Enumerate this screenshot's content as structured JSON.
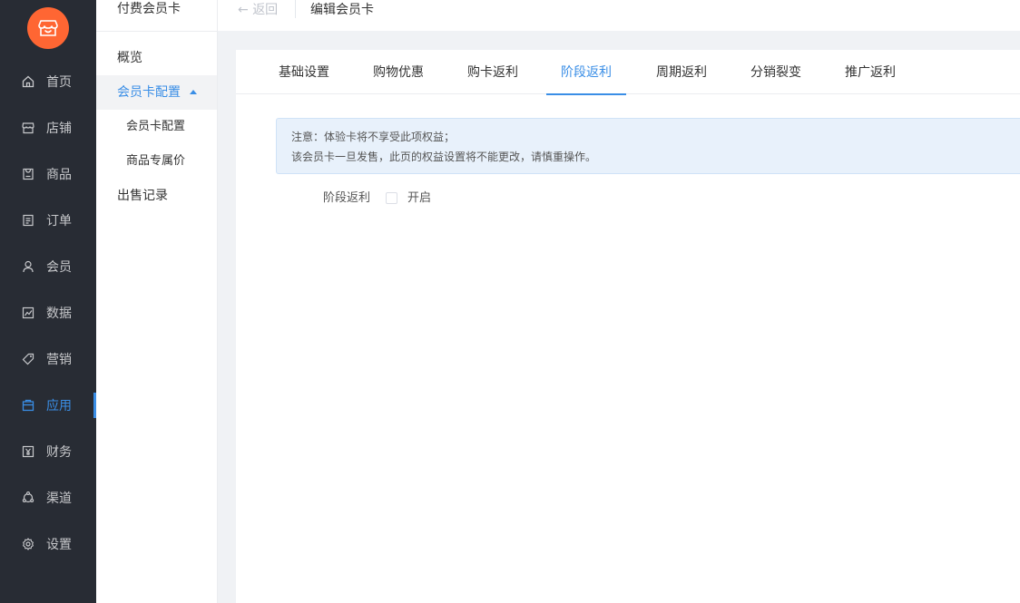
{
  "nav": {
    "items": [
      {
        "label": "首页",
        "icon": "home-icon"
      },
      {
        "label": "店铺",
        "icon": "store-icon"
      },
      {
        "label": "商品",
        "icon": "goods-icon"
      },
      {
        "label": "订单",
        "icon": "order-icon"
      },
      {
        "label": "会员",
        "icon": "user-icon"
      },
      {
        "label": "数据",
        "icon": "chart-icon"
      },
      {
        "label": "营销",
        "icon": "tag-icon"
      },
      {
        "label": "应用",
        "icon": "app-icon",
        "active": true
      },
      {
        "label": "财务",
        "icon": "finance-icon"
      },
      {
        "label": "渠道",
        "icon": "channel-icon"
      },
      {
        "label": "设置",
        "icon": "gear-icon"
      }
    ]
  },
  "subnav": {
    "title": "付费会员卡",
    "items": [
      {
        "label": "概览"
      },
      {
        "label": "会员卡配置",
        "expanded": true
      },
      {
        "label": "会员卡配置"
      },
      {
        "label": "商品专属价"
      },
      {
        "label": "出售记录"
      }
    ]
  },
  "topbar": {
    "back_label": "返回",
    "title": "编辑会员卡"
  },
  "tabs": [
    {
      "label": "基础设置"
    },
    {
      "label": "购物优惠"
    },
    {
      "label": "购卡返利"
    },
    {
      "label": "阶段返利",
      "active": true
    },
    {
      "label": "周期返利"
    },
    {
      "label": "分销裂变"
    },
    {
      "label": "推广返利"
    }
  ],
  "notice": {
    "line1": "注意：体验卡将不享受此项权益；",
    "line2": "该会员卡一旦发售，此页的权益设置将不能更改，请慎重操作。"
  },
  "form": {
    "label": "阶段返利",
    "checkbox_label": "开启",
    "checked": false
  },
  "colors": {
    "accent": "#3a8ee6",
    "logo": "#ff6633",
    "nav_bg": "#282c34"
  }
}
